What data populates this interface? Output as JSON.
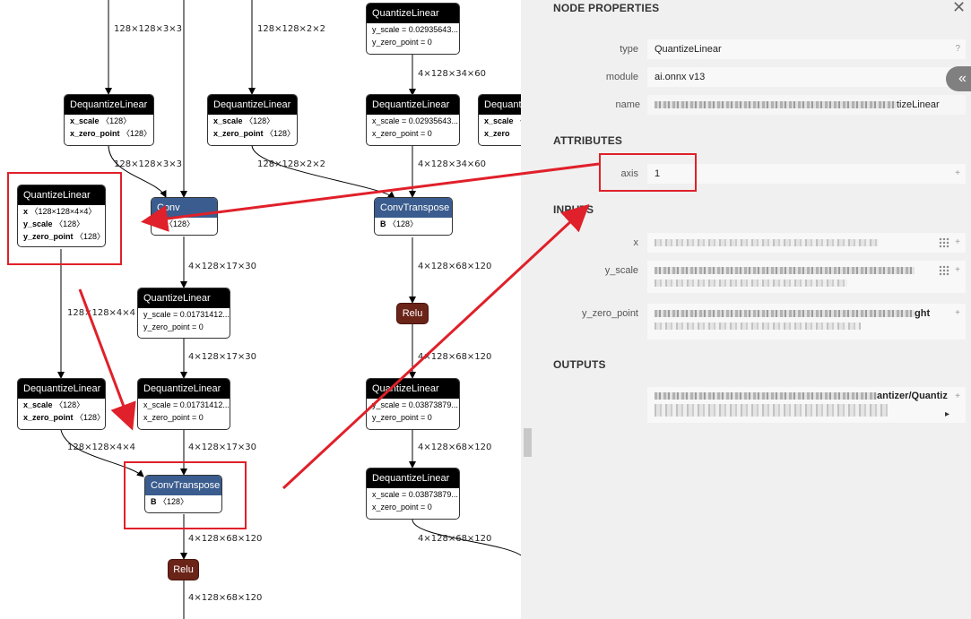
{
  "graph": {
    "nodes": [
      {
        "id": "q1",
        "title": "QuantizeLinear",
        "kind": "black",
        "rows": [
          [
            "",
            "y_scale = 0.02935643..."
          ],
          [
            "",
            "y_zero_point = 0"
          ]
        ]
      },
      {
        "id": "d1",
        "title": "DequantizeLinear",
        "kind": "black",
        "rows": [
          [
            "x_scale",
            "〈128〉"
          ],
          [
            "x_zero_point",
            "〈128〉"
          ]
        ]
      },
      {
        "id": "d2",
        "title": "DequantizeLinear",
        "kind": "black",
        "rows": [
          [
            "x_scale",
            "〈128〉"
          ],
          [
            "x_zero_point",
            "〈128〉"
          ]
        ]
      },
      {
        "id": "d3",
        "title": "DequantizeLinear",
        "kind": "black",
        "rows": [
          [
            "",
            "x_scale = 0.02935643..."
          ],
          [
            "",
            "x_zero_point = 0"
          ]
        ]
      },
      {
        "id": "d4",
        "title": "Dequant",
        "kind": "black",
        "rows": [
          [
            "x_scale",
            "〈"
          ],
          [
            "x_zero",
            ""
          ]
        ]
      },
      {
        "id": "q2",
        "title": "QuantizeLinear",
        "kind": "black",
        "rows": [
          [
            "x",
            "〈128×128×4×4〉"
          ],
          [
            "y_scale",
            "〈128〉"
          ],
          [
            "y_zero_point",
            "〈128〉"
          ]
        ]
      },
      {
        "id": "conv",
        "title": "Conv",
        "kind": "blue",
        "rows": [
          [
            "B",
            "〈128〉"
          ]
        ]
      },
      {
        "id": "ct1",
        "title": "ConvTranspose",
        "kind": "blue",
        "rows": [
          [
            "B",
            "〈128〉"
          ]
        ]
      },
      {
        "id": "q3",
        "title": "QuantizeLinear",
        "kind": "black",
        "rows": [
          [
            "",
            "y_scale = 0.01731412..."
          ],
          [
            "",
            "y_zero_point = 0"
          ]
        ]
      },
      {
        "id": "relu1",
        "title": "Relu",
        "kind": "relu",
        "rows": []
      },
      {
        "id": "d5",
        "title": "DequantizeLinear",
        "kind": "black",
        "rows": [
          [
            "x_scale",
            "〈128〉"
          ],
          [
            "x_zero_point",
            "〈128〉"
          ]
        ]
      },
      {
        "id": "d6",
        "title": "DequantizeLinear",
        "kind": "black",
        "rows": [
          [
            "",
            "x_scale = 0.01731412..."
          ],
          [
            "",
            "x_zero_point = 0"
          ]
        ]
      },
      {
        "id": "q4",
        "title": "QuantizeLinear",
        "kind": "black",
        "rows": [
          [
            "",
            "y_scale = 0.03873879..."
          ],
          [
            "",
            "y_zero_point = 0"
          ]
        ]
      },
      {
        "id": "ct2",
        "title": "ConvTranspose",
        "kind": "blue",
        "rows": [
          [
            "B",
            "〈128〉"
          ]
        ]
      },
      {
        "id": "d7",
        "title": "DequantizeLinear",
        "kind": "black",
        "rows": [
          [
            "",
            "x_scale = 0.03873879..."
          ],
          [
            "",
            "x_zero_point = 0"
          ]
        ]
      },
      {
        "id": "relu2",
        "title": "Relu",
        "kind": "relu",
        "rows": []
      }
    ],
    "edge_labels": [
      "128×128×3×3",
      "128×128×2×2",
      "4×128×34×60",
      "128×128×3×3",
      "128×128×2×2",
      "4×128×34×60",
      "4×128×17×30",
      "4×128×68×120",
      "128×128×4×4",
      "4×128×17×30",
      "4×128×68×120",
      "128×128×4×4",
      "4×128×17×30",
      "4×128×68×120",
      "4×128×68×120",
      "4×128×68×120",
      "4×128×68×120"
    ]
  },
  "panel": {
    "title": "NODE PROPERTIES",
    "close_icon": "close-icon",
    "collapse_icon": "double-chevron-left-icon",
    "props": {
      "type_label": "type",
      "type_value": "QuantizeLinear",
      "type_help": "?",
      "module_label": "module",
      "module_value": "ai.onnx v13",
      "name_label": "name",
      "name_value_tail": "tizeLinear"
    },
    "attributes": {
      "section": "ATTRIBUTES",
      "axis_label": "axis",
      "axis_value": "1",
      "axis_expand": "+"
    },
    "inputs": {
      "section": "INPUTS",
      "x_label": "x",
      "y_scale_label": "y_scale",
      "y_zero_point_label": "y_zero_point",
      "y_zero_point_tail": "ght",
      "expand": "+"
    },
    "outputs": {
      "section": "OUTPUTS",
      "output_tail": "antizer/Quantiz",
      "expand": "+",
      "scroll_arrow": "▸"
    }
  },
  "colors": {
    "annotation": "#e0202a",
    "node_header": "#000000",
    "node_blue": "#3a5c8e",
    "relu": "#6b2418"
  }
}
